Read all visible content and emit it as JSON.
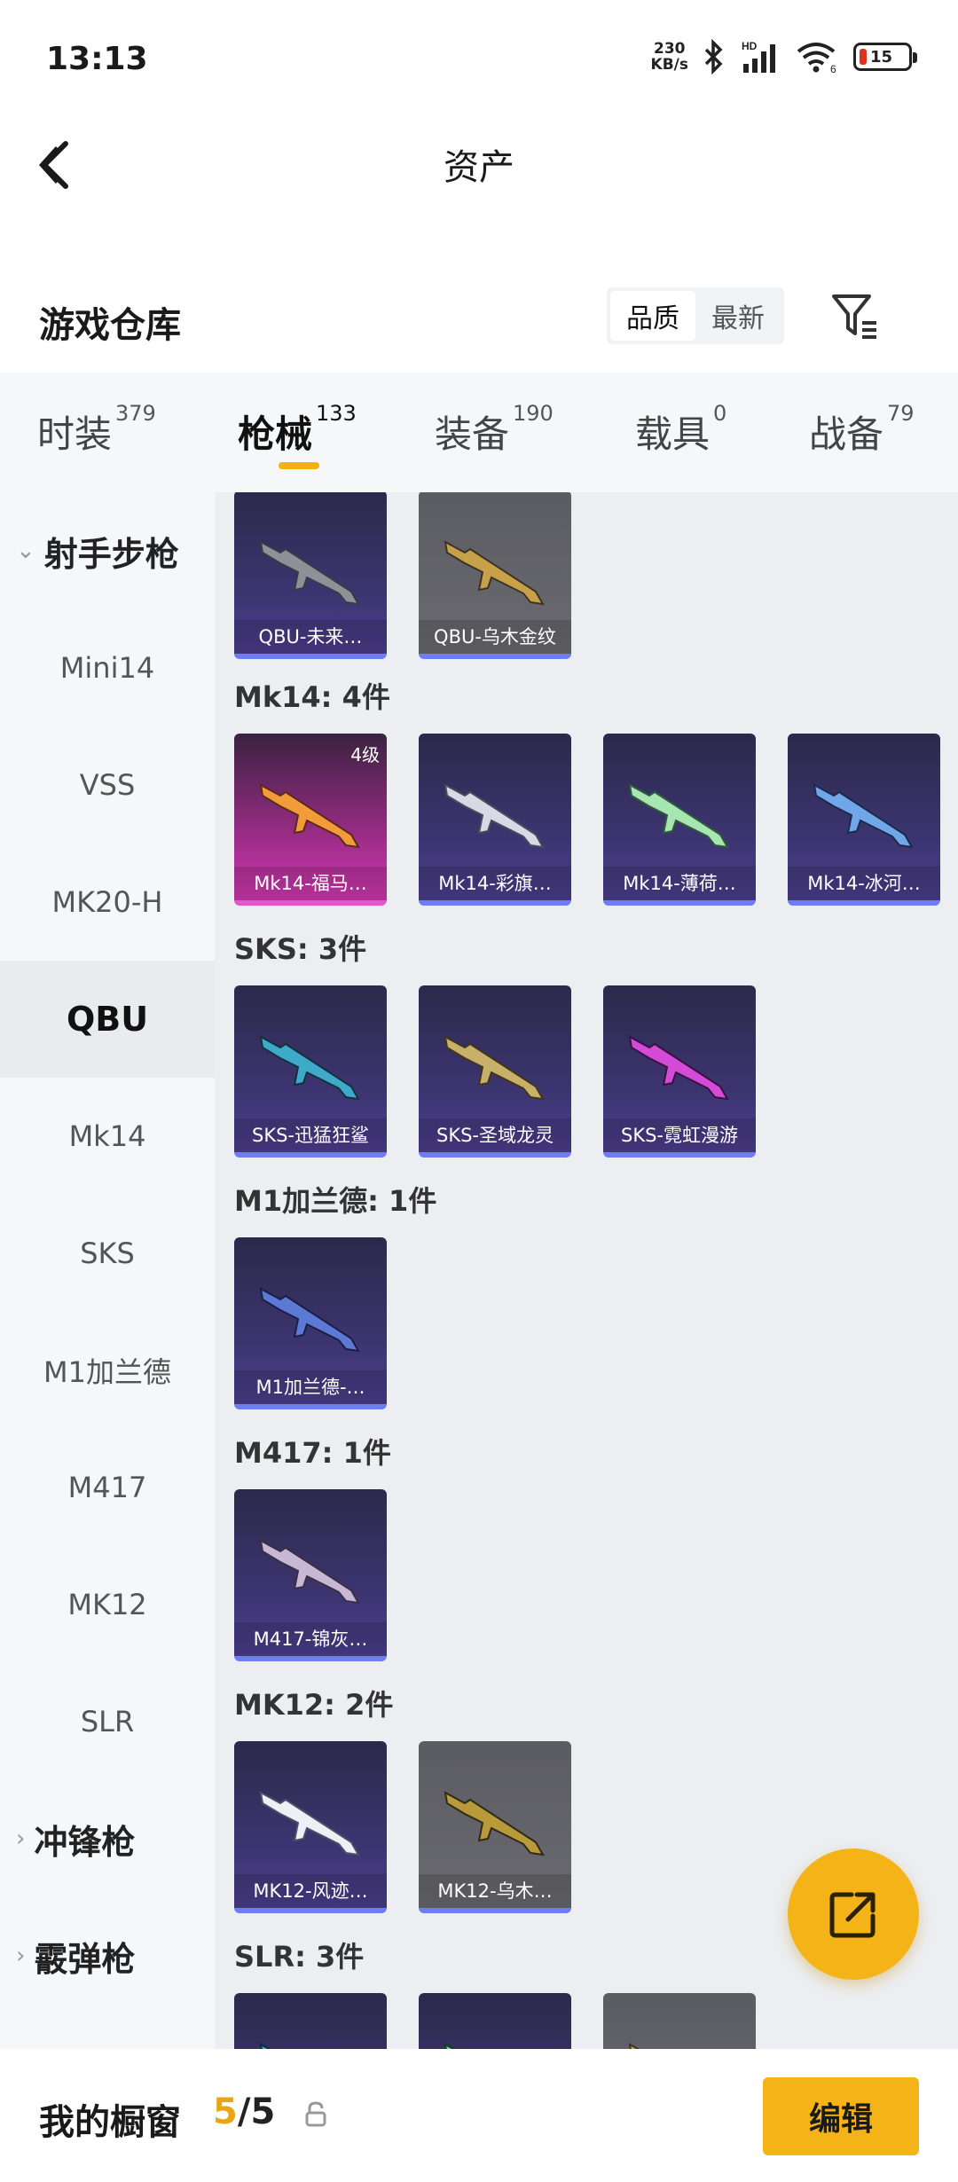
{
  "status": {
    "time": "13:13",
    "speed_value": "230",
    "speed_unit": "KB/s",
    "battery": "15",
    "wifi_label": "6"
  },
  "header": {
    "title": "资产"
  },
  "warehouse": {
    "title": "游戏仓库",
    "sort": [
      "品质",
      "最新"
    ]
  },
  "tabs": [
    {
      "label": "时装",
      "count": "379"
    },
    {
      "label": "枪械",
      "count": "133"
    },
    {
      "label": "装备",
      "count": "190"
    },
    {
      "label": "载具",
      "count": "0"
    },
    {
      "label": "战备",
      "count": "79"
    }
  ],
  "sidebar": {
    "group1": "射手步枪",
    "items": [
      "Mini14",
      "VSS",
      "MK20-H",
      "QBU",
      "Mk14",
      "SKS",
      "M1加兰德",
      "M417",
      "MK12",
      "SLR"
    ],
    "group2": "冲锋枪",
    "group3": "霰弹枪"
  },
  "groups": {
    "mk14": "Mk14: 4件",
    "sks": "SKS: 3件",
    "m1": "M1加兰德: 1件",
    "m417": "M417: 1件",
    "mk12": "MK12: 2件",
    "slr": "SLR: 3件"
  },
  "items": {
    "qbu1": "QBU-未来…",
    "qbu2": "QBU-乌木金纹",
    "mk14_1": "Mk14-福马…",
    "mk14_1_level": "4级",
    "mk14_2": "Mk14-彩旗…",
    "mk14_3": "Mk14-薄荷…",
    "mk14_4": "Mk14-冰河…",
    "sks1": "SKS-迅猛狂鲨",
    "sks2": "SKS-圣域龙灵",
    "sks3": "SKS-霓虹漫游",
    "m1_1": "M1加兰德-…",
    "m417_1": "M417-锦灰…",
    "mk12_1": "MK12-风迹…",
    "mk12_2": "MK12-乌木…"
  },
  "bottom": {
    "title": "我的橱窗",
    "current": "5",
    "total": "/5",
    "edit": "编辑"
  },
  "colors": {
    "accent": "#f4b316",
    "rarity_purple": "#6d7df2"
  }
}
